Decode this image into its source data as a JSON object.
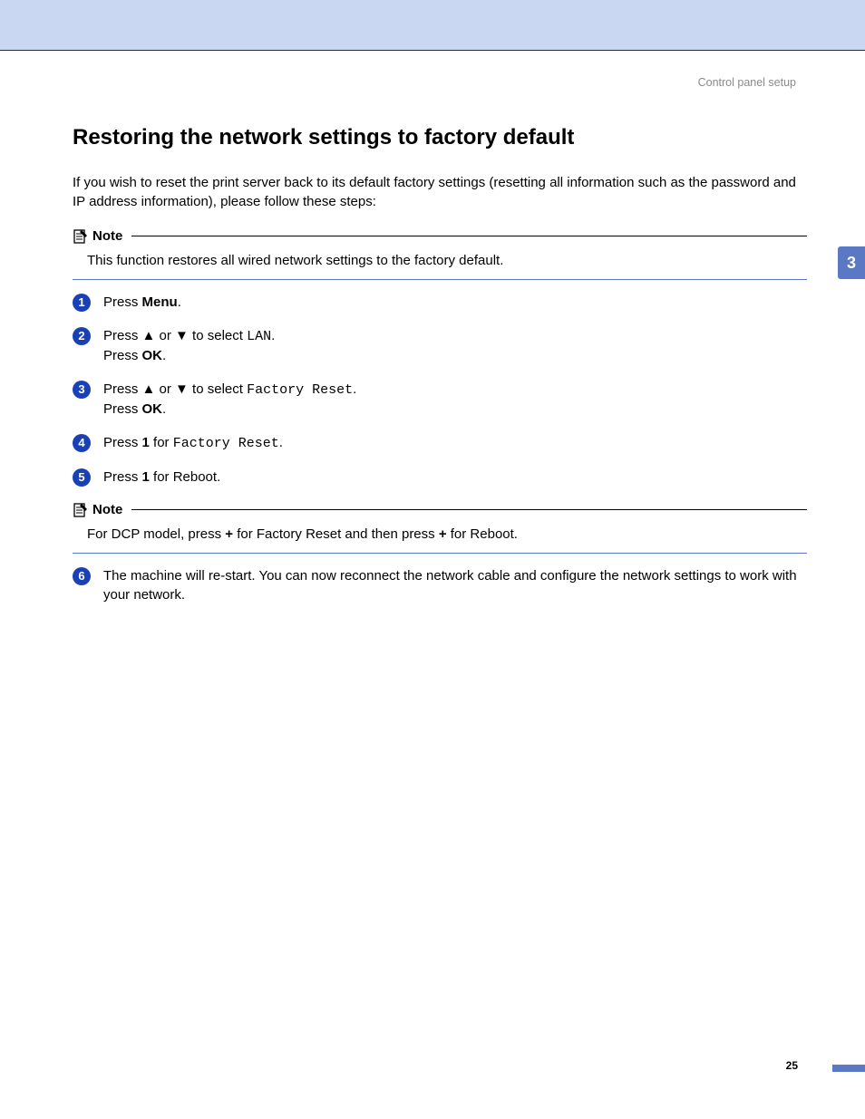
{
  "header": {
    "label": "Control panel setup"
  },
  "section": {
    "title": "Restoring the network settings to factory default",
    "intro": "If you wish to reset the print server back to its default factory settings (resetting all information such as the password and IP address information), please follow these steps:"
  },
  "note1": {
    "label": "Note",
    "body": "This function restores all wired network settings to the factory default."
  },
  "steps": {
    "s1": {
      "press": "Press ",
      "menu": "Menu",
      "end": "."
    },
    "s2": {
      "press": "Press ",
      "arrows": "▲ or ▼",
      "sel": " to select ",
      "opt": "LAN",
      "end": ".",
      "ok1": "Press ",
      "ok2": "OK",
      "okend": "."
    },
    "s3": {
      "press": "Press ",
      "arrows": "▲ or ▼",
      "sel": " to select ",
      "opt": "Factory Reset",
      "end": ".",
      "ok1": "Press ",
      "ok2": "OK",
      "okend": "."
    },
    "s4": {
      "press": "Press ",
      "one": "1",
      "for": " for ",
      "opt": "Factory Reset",
      "end": "."
    },
    "s5": {
      "press": "Press ",
      "one": "1",
      "for": " for Reboot."
    }
  },
  "note2": {
    "label": "Note",
    "pre": "For DCP model, press ",
    "plus1": "+",
    "mid": " for Factory Reset and then press ",
    "plus2": "+",
    "post": "  for Reboot."
  },
  "steps2": {
    "s6": "The machine will re-start. You can now reconnect the network cable and configure the network settings to work with your network."
  },
  "tab": "3",
  "page": "25"
}
